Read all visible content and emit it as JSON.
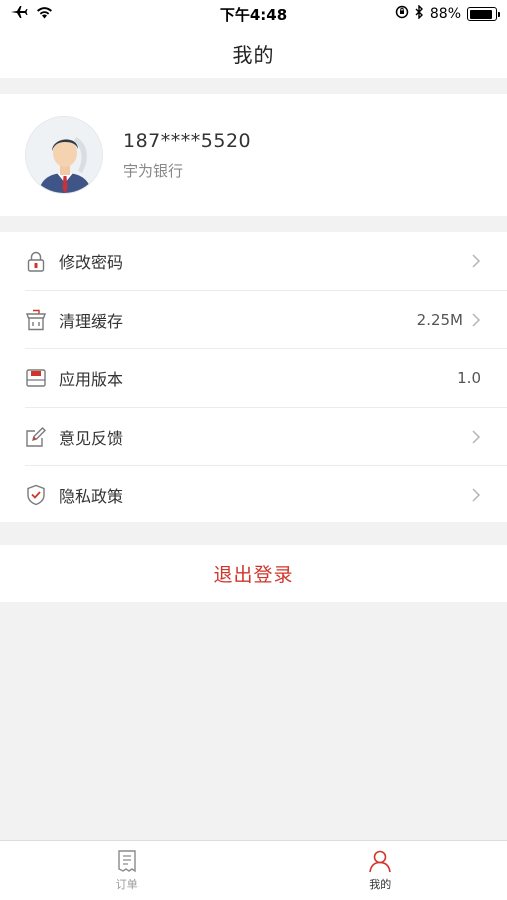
{
  "status_bar": {
    "time": "下午4:48",
    "battery_percent": "88%",
    "battery_level": 0.88
  },
  "nav": {
    "title": "我的"
  },
  "profile": {
    "phone": "187****5520",
    "bank": "宇为银行"
  },
  "menu": {
    "items": [
      {
        "label": "修改密码",
        "icon": "lock-icon",
        "value": "",
        "has_arrow": true
      },
      {
        "label": "清理缓存",
        "icon": "clean-cache-icon",
        "value": "2.25M",
        "has_arrow": true
      },
      {
        "label": "应用版本",
        "icon": "version-icon",
        "value": "1.0",
        "has_arrow": false
      },
      {
        "label": "意见反馈",
        "icon": "feedback-edit-icon",
        "value": "",
        "has_arrow": true
      },
      {
        "label": "隐私政策",
        "icon": "privacy-shield-icon",
        "value": "",
        "has_arrow": true
      }
    ]
  },
  "logout": {
    "label": "退出登录"
  },
  "tab_bar": {
    "tabs": [
      {
        "label": "订单",
        "icon": "order-document-icon",
        "active": false
      },
      {
        "label": "我的",
        "icon": "user-profile-icon",
        "active": true
      }
    ]
  },
  "colors": {
    "accent_red": "#d0352b",
    "background": "#f2f2f2"
  }
}
